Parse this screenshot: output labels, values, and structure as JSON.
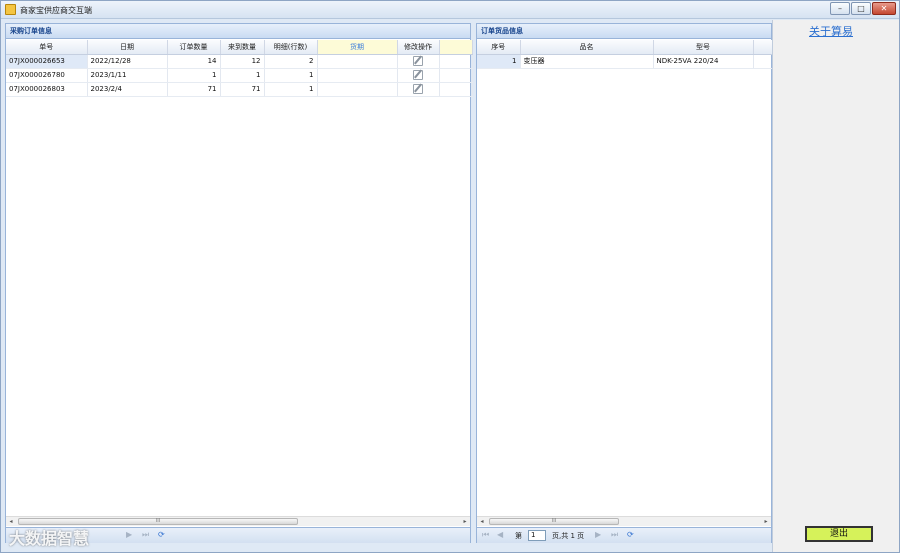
{
  "window": {
    "title": "商家宝供应商交互端",
    "min": "–",
    "max": "□",
    "close": "✕"
  },
  "left_panel": {
    "title": "采购订单信息",
    "columns": [
      "单号",
      "日期",
      "订单数量",
      "来到数量",
      "明细(行数)",
      "货期",
      "修改操作"
    ],
    "rows": [
      {
        "no": "07JX000026653",
        "date": "2022/12/28",
        "qty": "14",
        "arrived": "12",
        "lines": "2",
        "due": ""
      },
      {
        "no": "07JX000026780",
        "date": "2023/1/11",
        "qty": "1",
        "arrived": "1",
        "lines": "1",
        "due": ""
      },
      {
        "no": "07JX000026803",
        "date": "2023/2/4",
        "qty": "71",
        "arrived": "71",
        "lines": "1",
        "due": ""
      }
    ],
    "scroll_mid": "III"
  },
  "right_panel": {
    "title": "订单货品信息",
    "columns": [
      "序号",
      "品名",
      "型号"
    ],
    "rows": [
      {
        "seq": "1",
        "name": "变压器",
        "model": "NDK-25VA 220/24"
      }
    ],
    "scroll_mid": "III",
    "pager": {
      "page_label": "第",
      "page_value": "1",
      "page_suffix": "页,共 1 页"
    }
  },
  "sidebar": {
    "about_link": "关于算易",
    "exit_button": "退出"
  },
  "watermark": "大数据智慧",
  "icons": {
    "first": "⏮",
    "prev": "◀",
    "next": "▶",
    "last": "⏭",
    "refresh": "⟳",
    "scroll_left": "◂",
    "scroll_right": "▸"
  }
}
